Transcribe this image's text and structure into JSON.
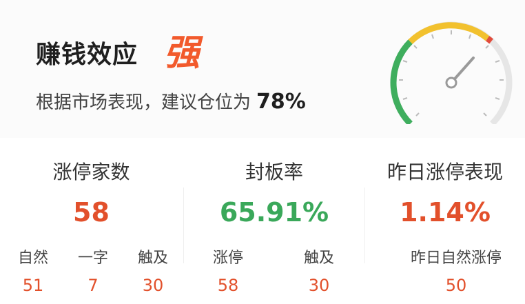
{
  "header": {
    "title": "赚钱效应",
    "strength": "强",
    "subtitle": "根据市场表现，建议仓位为",
    "position_pct": "78%"
  },
  "gauge": {
    "value_fraction": 0.78,
    "colors": {
      "green": "#3fae5e",
      "yellow": "#f2c12e",
      "red": "#e24b3b",
      "gray": "#e6e6e6"
    }
  },
  "stats": {
    "limit_up": {
      "title": "涨停家数",
      "value": "58",
      "labels": [
        "自然",
        "一字",
        "触及"
      ],
      "values": [
        "51",
        "7",
        "30"
      ]
    },
    "seal_rate": {
      "title": "封板率",
      "value": "65.91%",
      "labels": [
        "涨停",
        "触及"
      ],
      "values": [
        "58",
        "30"
      ]
    },
    "yesterday": {
      "title": "昨日涨停表现",
      "value": "1.14%",
      "label": "昨日自然涨停",
      "subvalue": "50"
    }
  },
  "colors": {
    "accent_red": "#e2502b",
    "accent_green": "#3aa85a",
    "strength_orange": "#f25a2c"
  }
}
